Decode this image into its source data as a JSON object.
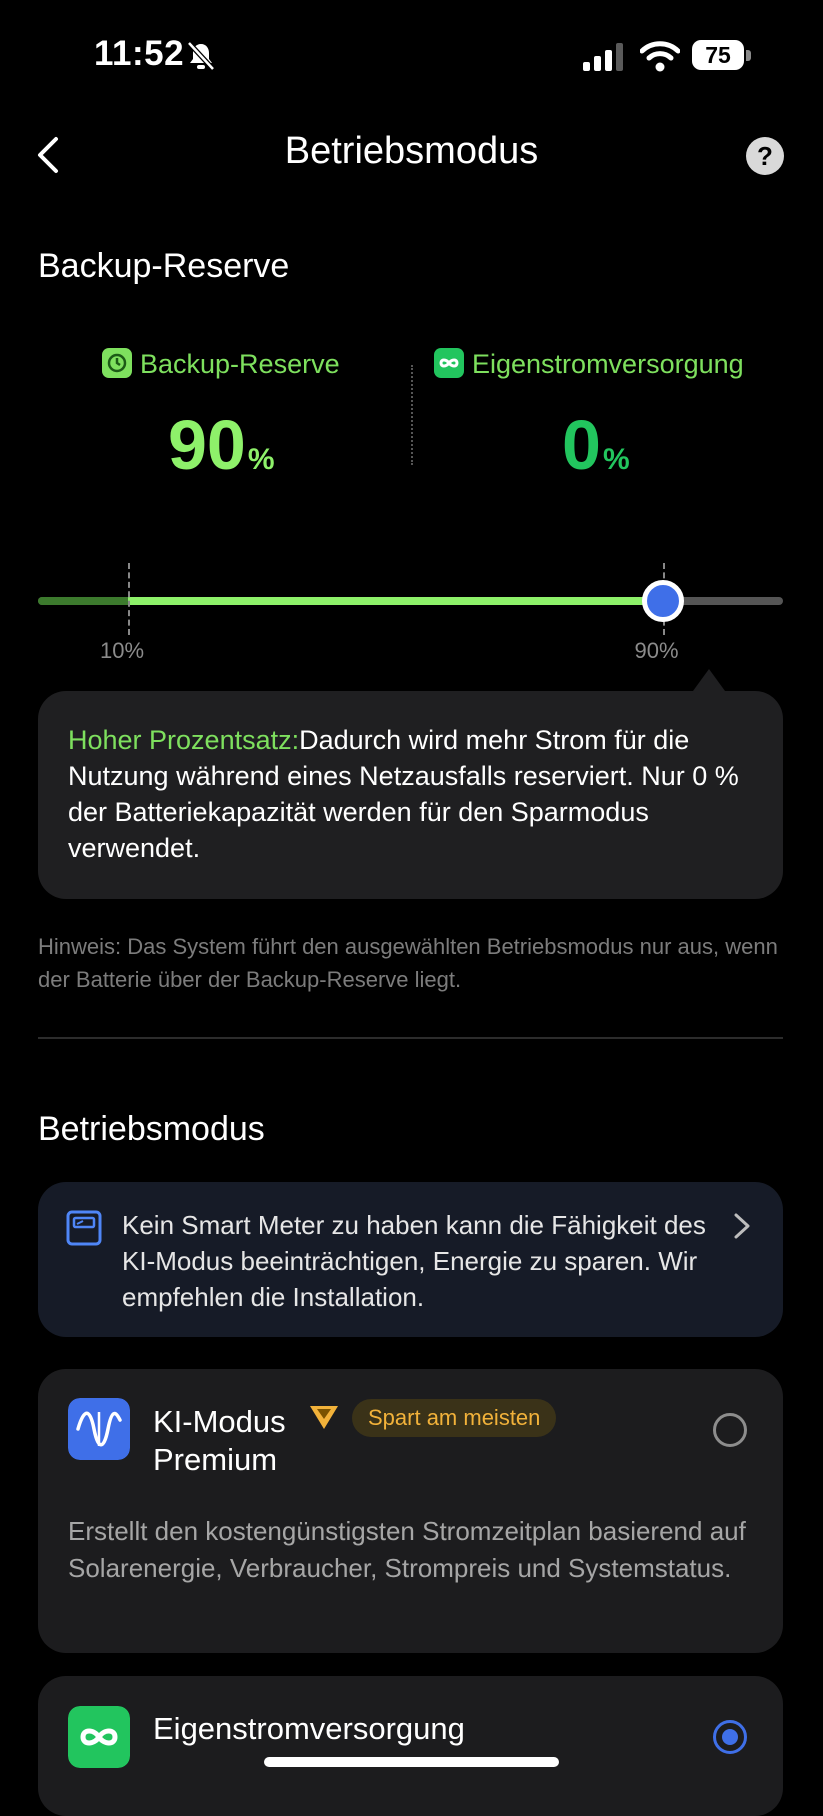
{
  "status_bar": {
    "time": "11:52",
    "battery": "75"
  },
  "header": {
    "title": "Betriebsmodus",
    "help": "?"
  },
  "backup": {
    "section_title": "Backup-Reserve",
    "reserve_label": "Backup-Reserve",
    "reserve_value": "90",
    "self_label": "Eigenstromversorgung",
    "self_value": "0",
    "percent_sign": "%",
    "slider": {
      "value_percent": 90,
      "min_marker_percent": 10,
      "min_label": "10%",
      "value_label": "90%"
    },
    "tooltip_highlight": "Hoher Prozentsatz:",
    "tooltip_text": "Dadurch wird mehr Strom für die Nutzung während eines Netzausfalls reserviert. Nur 0 % der Batteriekapazität werden für den Sparmodus verwendet.",
    "hint": "Hinweis: Das System führt den ausgewählten Betriebsmodus nur aus, wenn der Batterie über der Backup-Reserve liegt."
  },
  "mode": {
    "section_title": "Betriebsmodus",
    "banner_text": "Kein Smart Meter zu haben kann die Fähigkeit des KI-Modus beeinträchtigen, Energie zu sparen. Wir empfehlen die Installation.",
    "ai_mode": {
      "title_line1": "KI-Modus",
      "title_line2": "Premium",
      "badge": "Spart am meisten",
      "description": "Erstellt den kostengünstigsten Stromzeitplan basierend auf Solarenergie, Verbraucher, Strompreis und Systemstatus.",
      "selected": false
    },
    "self_supply": {
      "title": "Eigenstromversorgung",
      "selected": true
    }
  },
  "colors": {
    "green": "#8ef16a",
    "blue": "#3f6fe8",
    "gold": "#f2b23a",
    "card": "#1c1c1e"
  }
}
